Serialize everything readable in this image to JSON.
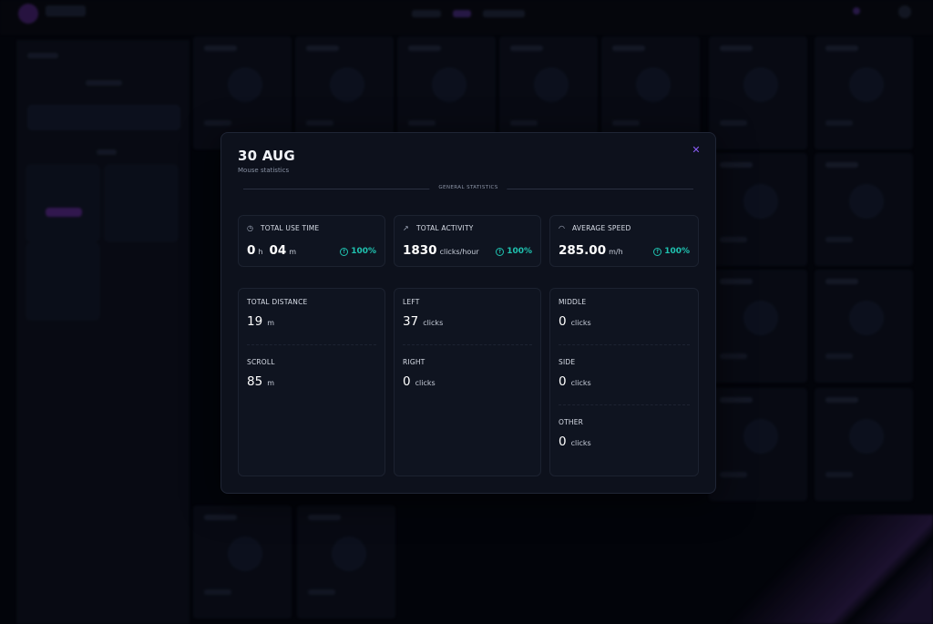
{
  "modal": {
    "title": "30 AUG",
    "subtitle": "Mouse statistics",
    "close_icon": "close-icon",
    "section_label": "GENERAL STATISTICS"
  },
  "summary": [
    {
      "label": "TOTAL USE TIME",
      "icon": "clock-icon",
      "hours": "0",
      "hours_unit": "h",
      "minutes": "04",
      "minutes_unit": "m",
      "change": "100%"
    },
    {
      "label": "TOTAL ACTIVITY",
      "icon": "trend-up-icon",
      "value": "1830",
      "unit": "clicks/hour",
      "change": "100%"
    },
    {
      "label": "AVERAGE SPEED",
      "icon": "speedometer-icon",
      "value": "285.00",
      "unit": "m/h",
      "change": "100%"
    }
  ],
  "details": {
    "distance": [
      {
        "label": "TOTAL DISTANCE",
        "value": "19",
        "unit": "m"
      },
      {
        "label": "SCROLL",
        "value": "85",
        "unit": "m"
      }
    ],
    "buttons_a": [
      {
        "label": "LEFT",
        "value": "37",
        "unit": "clicks"
      },
      {
        "label": "RIGHT",
        "value": "0",
        "unit": "clicks"
      }
    ],
    "buttons_b": [
      {
        "label": "MIDDLE",
        "value": "0",
        "unit": "clicks"
      },
      {
        "label": "SIDE",
        "value": "0",
        "unit": "clicks"
      },
      {
        "label": "OTHER",
        "value": "0",
        "unit": "clicks"
      }
    ]
  },
  "colors": {
    "accent": "#8b5cf6",
    "positive": "#1fc2b0",
    "modal_bg": "#0d111c"
  }
}
